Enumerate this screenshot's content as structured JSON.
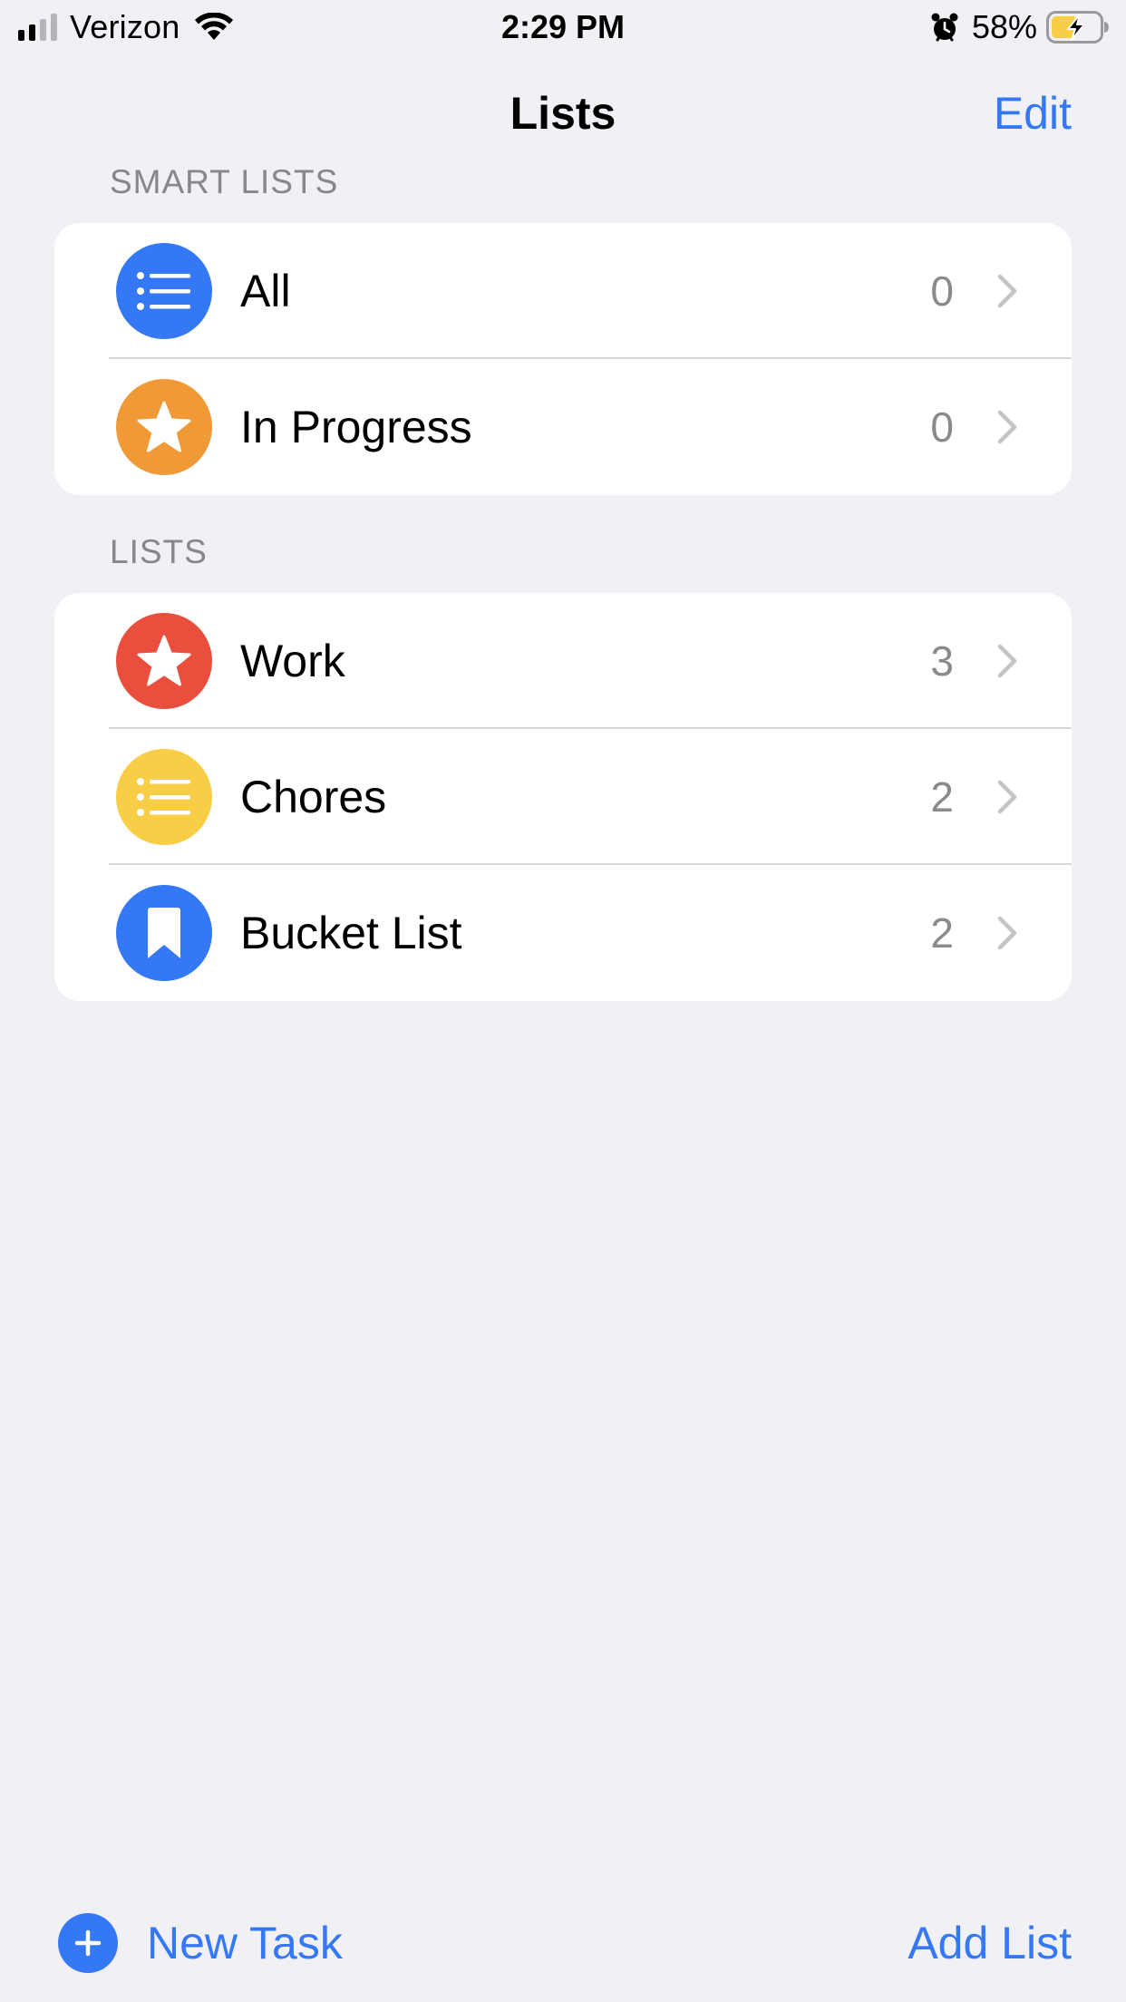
{
  "status_bar": {
    "carrier": "Verizon",
    "time": "2:29 PM",
    "battery_percent": "58%",
    "signal_bars_active": 2,
    "signal_bars_total": 4
  },
  "nav": {
    "title": "Lists",
    "edit_label": "Edit"
  },
  "smart_lists": {
    "header": "SMART LISTS",
    "items": [
      {
        "label": "All",
        "count": "0",
        "icon": "list-icon",
        "color": "#3478f6"
      },
      {
        "label": "In Progress",
        "count": "0",
        "icon": "star-icon",
        "color": "#f09a37"
      }
    ]
  },
  "lists": {
    "header": "LISTS",
    "items": [
      {
        "label": "Work",
        "count": "3",
        "icon": "star-icon",
        "color": "#ea4e3d"
      },
      {
        "label": "Chores",
        "count": "2",
        "icon": "list-icon",
        "color": "#f7ce46"
      },
      {
        "label": "Bucket List",
        "count": "2",
        "icon": "bookmark-icon",
        "color": "#3478f6"
      }
    ]
  },
  "toolbar": {
    "new_task_label": "New Task",
    "add_list_label": "Add List"
  },
  "colors": {
    "accent": "#3478f6",
    "background": "#f0f0f5",
    "battery_fill": "#f7ce46"
  }
}
